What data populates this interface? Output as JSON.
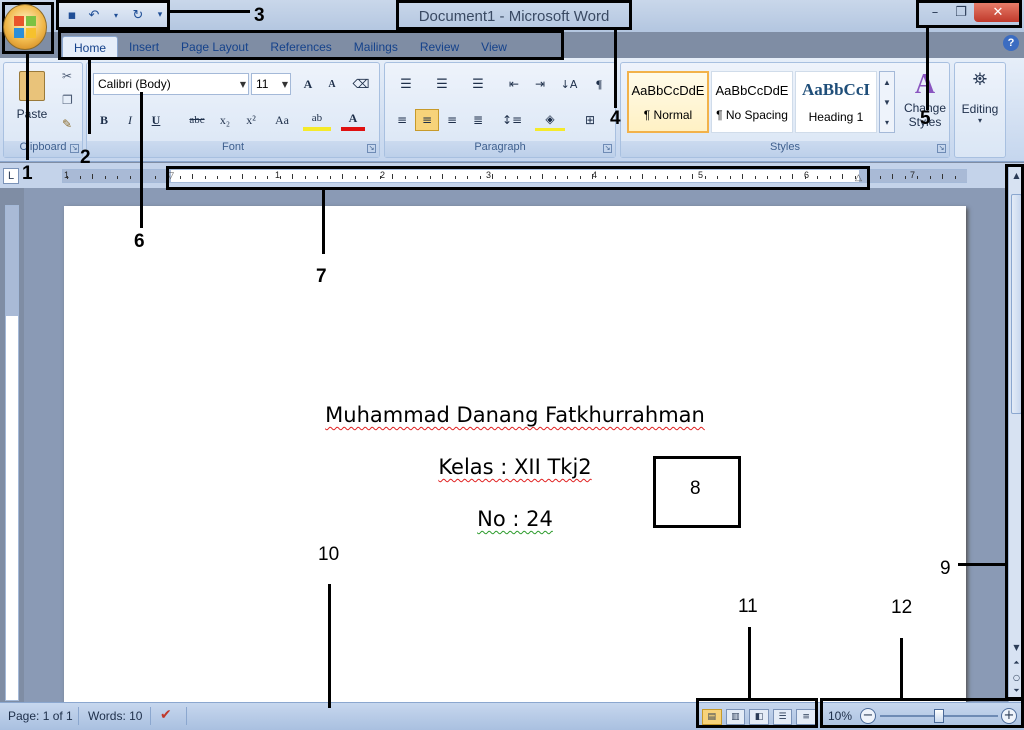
{
  "window": {
    "title": "Document1 - Microsoft Word",
    "minimize": "–",
    "maximize": "❐",
    "close": "✕"
  },
  "quick_access": {
    "save_icon": "save-icon",
    "undo_icon": "undo-icon",
    "redo_icon": "redo-icon",
    "customize_icon": "dropdown-icon"
  },
  "tabs": [
    "Home",
    "Insert",
    "Page Layout",
    "References",
    "Mailings",
    "Review",
    "View"
  ],
  "active_tab": "Home",
  "ribbon": {
    "clipboard": {
      "label": "Clipboard",
      "paste": "Paste"
    },
    "font": {
      "label": "Font",
      "font_name": "Calibri (Body)",
      "font_size": "11",
      "grow": "A",
      "shrink": "A",
      "bold": "B",
      "italic": "I",
      "underline": "U",
      "strike": "abc",
      "subscript": "x₂",
      "superscript": "x²",
      "change_case": "Aa",
      "highlight": "ab",
      "font_color": "A"
    },
    "paragraph": {
      "label": "Paragraph",
      "pilcrow": "¶"
    },
    "styles": {
      "label": "Styles",
      "items": [
        {
          "preview": "AaBbCcDdE",
          "name": "¶ Normal"
        },
        {
          "preview": "AaBbCcDdE",
          "name": "¶ No Spacing"
        },
        {
          "preview": "AaBbCcI",
          "name": "Heading 1"
        }
      ],
      "change_styles": "Change Styles"
    },
    "editing": {
      "label": "Editing"
    }
  },
  "ruler": {
    "corner": "L",
    "numbers": [
      "1",
      "1",
      "2",
      "3",
      "4",
      "5",
      "6",
      "7"
    ]
  },
  "document": {
    "lines": [
      "Muhammad Danang Fatkhurrahman",
      "Kelas : XII Tkj2",
      "No : 24"
    ]
  },
  "status": {
    "page": "Page: 1 of 1",
    "words": "Words: 10",
    "zoom": "10%",
    "zoom_level": 0.5
  },
  "annotations": [
    "1",
    "2",
    "3",
    "4",
    "5",
    "6",
    "7",
    "8",
    "9",
    "10",
    "11",
    "12"
  ],
  "colors": {
    "ribbon_accent": "#15428b",
    "close_button": "#c0392b",
    "selected_style": "#f2b24a"
  }
}
